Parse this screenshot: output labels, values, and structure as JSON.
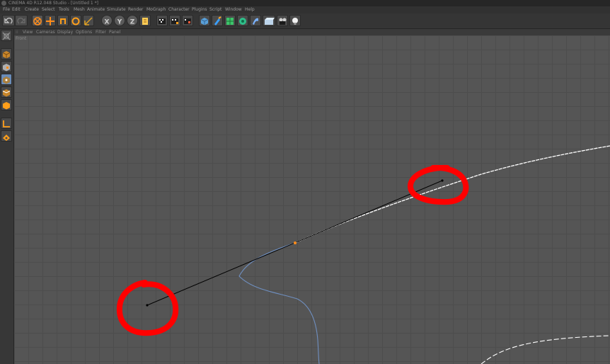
{
  "window": {
    "title": "CINEMA 4D R12.048 Studio - [Untitled 1 *]"
  },
  "menus": [
    "File",
    "Edit",
    "Create",
    "Select",
    "Tools",
    "Mesh",
    "Animate",
    "Simulate",
    "Render",
    "MoGraph",
    "Character",
    "Plugins",
    "Script",
    "Window",
    "Help"
  ],
  "toolbar": {
    "icons": [
      "undo-icon",
      "redo-icon",
      "move-icon",
      "scale-icon",
      "rotate-icon",
      "select-icon",
      "lock-x-icon",
      "lock-y-icon",
      "lock-z-icon",
      "world-coordinates-icon",
      "render-view-icon",
      "render-picture-icon",
      "render-settings-icon",
      "cube-object-icon",
      "pen-spline-icon",
      "subdivision-surface-icon",
      "array-icon",
      "deformer-icon",
      "floor-icon",
      "camera-icon",
      "light-icon"
    ],
    "axis_labels": [
      "X",
      "Y",
      "Z"
    ]
  },
  "left_tools": [
    "make-editable-icon",
    "model-mode-icon",
    "texture-mode-icon",
    "points-mode-icon",
    "edges-mode-icon",
    "polygons-mode-icon",
    "axis-mode-icon",
    "snap-icon"
  ],
  "viewport": {
    "menu": [
      "View",
      "Cameras",
      "Display",
      "Options",
      "Filter",
      "Panel"
    ],
    "label": "Front"
  },
  "colors": {
    "grid_bg": "#555555",
    "grid_line": "#4d4d4d",
    "annotation": "#ff0000",
    "spline_selected": "#ffffff",
    "spline_blue": "#6f8fc0",
    "handle_line": "#000000"
  }
}
